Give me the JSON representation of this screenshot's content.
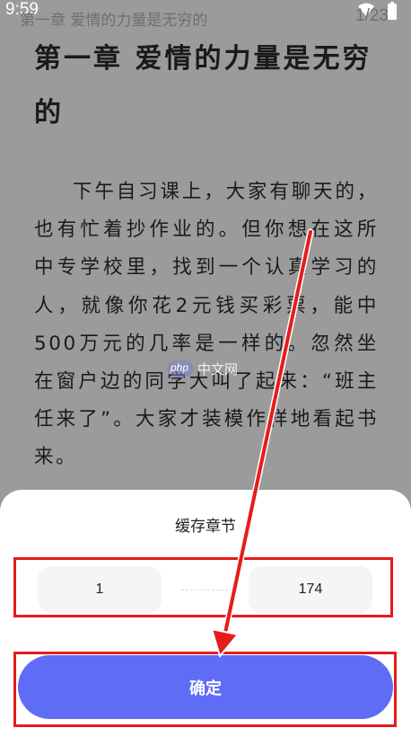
{
  "status_bar": {
    "time": "9:59"
  },
  "reader": {
    "running_title": "第一章 爱情的力量是无穷的",
    "page_number": "1/23",
    "chapter_title": "第一章 爱情的力量是无穷的",
    "body_text": "下午自习课上，大家有聊天的，也有忙着抄作业的。但你想在这所中专学校里，找到一个认真学习的人，就像你花2元钱买彩票，能中500万元的几率是一样的。忽然坐在窗户边的同学大叫了起来：“班主任来了”。大家才装模作样地看起书来。",
    "watermark": {
      "mark": "php",
      "text": "中文网"
    }
  },
  "cache_sheet": {
    "title": "缓存章节",
    "from_value": "1",
    "to_value": "174",
    "confirm_label": "确定"
  },
  "colors": {
    "accent": "#5f6cf5",
    "annotation": "#e51c1c"
  }
}
